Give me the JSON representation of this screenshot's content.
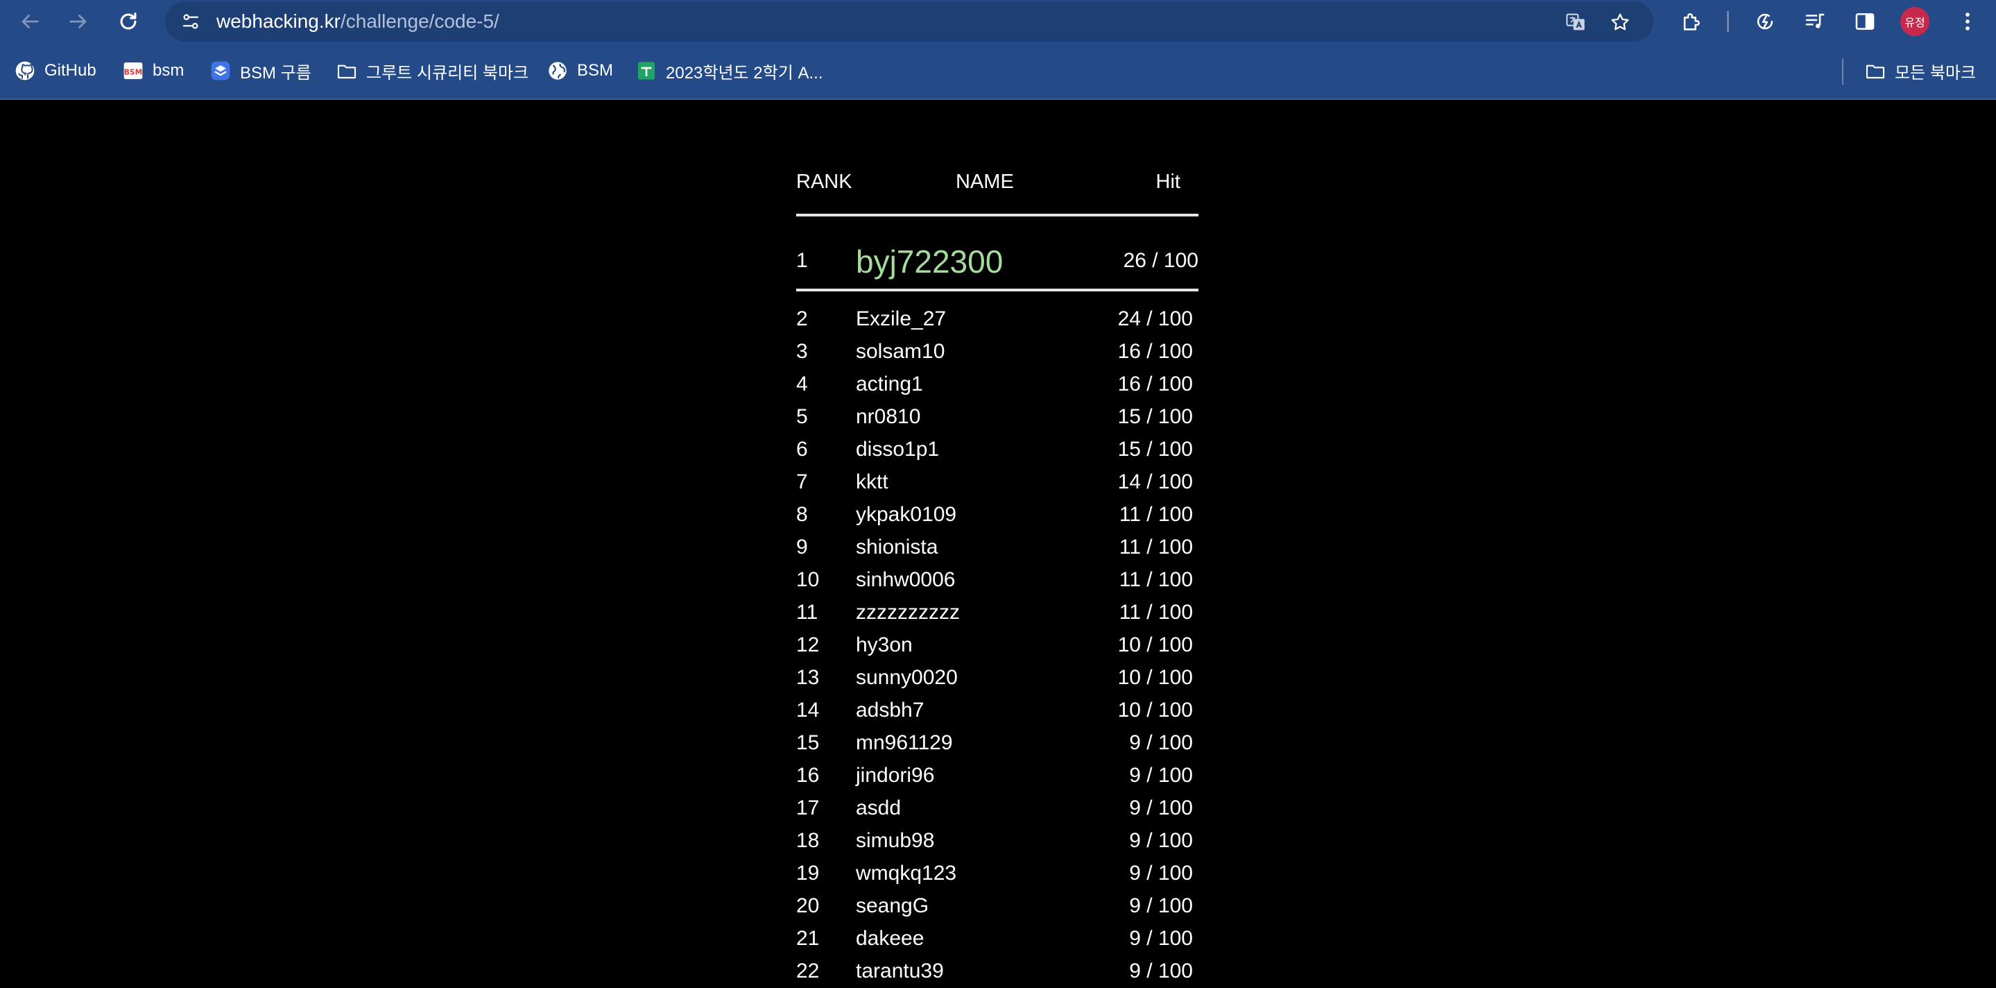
{
  "browser": {
    "url_host": "webhacking.kr",
    "url_path": "/challenge/code-5/",
    "avatar_text": "유정"
  },
  "bookmarks": [
    {
      "label": "GitHub",
      "icon": "github-icon"
    },
    {
      "label": "bsm",
      "icon": "bsm-favicon-icon"
    },
    {
      "label": "BSM 구름",
      "icon": "goorm-icon"
    },
    {
      "label": "그루트 시큐리티 북마크",
      "icon": "folder-icon"
    },
    {
      "label": "BSM",
      "icon": "globe-icon"
    },
    {
      "label": "2023학년도 2학기 A...",
      "icon": "sheets-icon"
    }
  ],
  "all_bookmarks_label": "모든 북마크",
  "colors": {
    "chrome_bg": "#244a87",
    "urlbar_bg": "#1e3f73",
    "page_bg": "#000000",
    "top_name": "#a6dc9b",
    "avatar": "#c8284b"
  },
  "ranking": {
    "headers": {
      "rank": "RANK",
      "name": "NAME",
      "hit": "Hit"
    },
    "top": {
      "rank": "1",
      "name": "byj722300",
      "hit": "26 / 100"
    },
    "rows": [
      {
        "rank": "2",
        "name": "Exzile_27",
        "hit": "24 / 100"
      },
      {
        "rank": "3",
        "name": "solsam10",
        "hit": "16 / 100"
      },
      {
        "rank": "4",
        "name": "acting1",
        "hit": "16 / 100"
      },
      {
        "rank": "5",
        "name": "nr0810",
        "hit": "15 / 100"
      },
      {
        "rank": "6",
        "name": "disso1p1",
        "hit": "15 / 100"
      },
      {
        "rank": "7",
        "name": "kktt",
        "hit": "14 / 100"
      },
      {
        "rank": "8",
        "name": "ykpak0109",
        "hit": "11 / 100"
      },
      {
        "rank": "9",
        "name": "shionista",
        "hit": "11 / 100"
      },
      {
        "rank": "10",
        "name": "sinhw0006",
        "hit": "11 / 100"
      },
      {
        "rank": "11",
        "name": "zzzzzzzzzz",
        "hit": "11 / 100"
      },
      {
        "rank": "12",
        "name": "hy3on",
        "hit": "10 / 100"
      },
      {
        "rank": "13",
        "name": "sunny0020",
        "hit": "10 / 100"
      },
      {
        "rank": "14",
        "name": "adsbh7",
        "hit": "10 / 100"
      },
      {
        "rank": "15",
        "name": "mn961129",
        "hit": "9 / 100"
      },
      {
        "rank": "16",
        "name": "jindori96",
        "hit": "9 / 100"
      },
      {
        "rank": "17",
        "name": "asdd",
        "hit": "9 / 100"
      },
      {
        "rank": "18",
        "name": "simub98",
        "hit": "9 / 100"
      },
      {
        "rank": "19",
        "name": "wmqkq123",
        "hit": "9 / 100"
      },
      {
        "rank": "20",
        "name": "seangG",
        "hit": "9 / 100"
      },
      {
        "rank": "21",
        "name": "dakeee",
        "hit": "9 / 100"
      },
      {
        "rank": "22",
        "name": "tarantu39",
        "hit": "9 / 100"
      }
    ]
  }
}
